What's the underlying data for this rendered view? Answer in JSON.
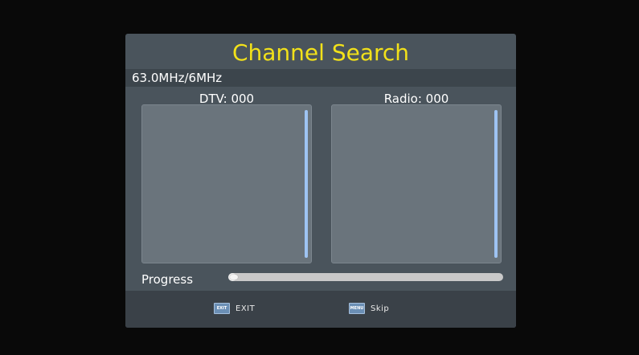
{
  "dialog": {
    "title": "Channel Search",
    "frequency": "63.0MHz/6MHz",
    "dtv_label": "DTV: 000",
    "radio_label": "Radio: 000",
    "progress_label": "Progress",
    "progress_fraction": 0.03
  },
  "footer": {
    "exit_icon_text": "EXIT",
    "exit_label": "EXIT",
    "menu_icon_text": "MENU",
    "skip_label": "Skip"
  },
  "colors": {
    "title": "#f2e11a",
    "panel": "#4a545c",
    "list_box": "#6a747c",
    "scrollbar": "#9ec3f2",
    "key_icon": "#6b8fb5"
  }
}
